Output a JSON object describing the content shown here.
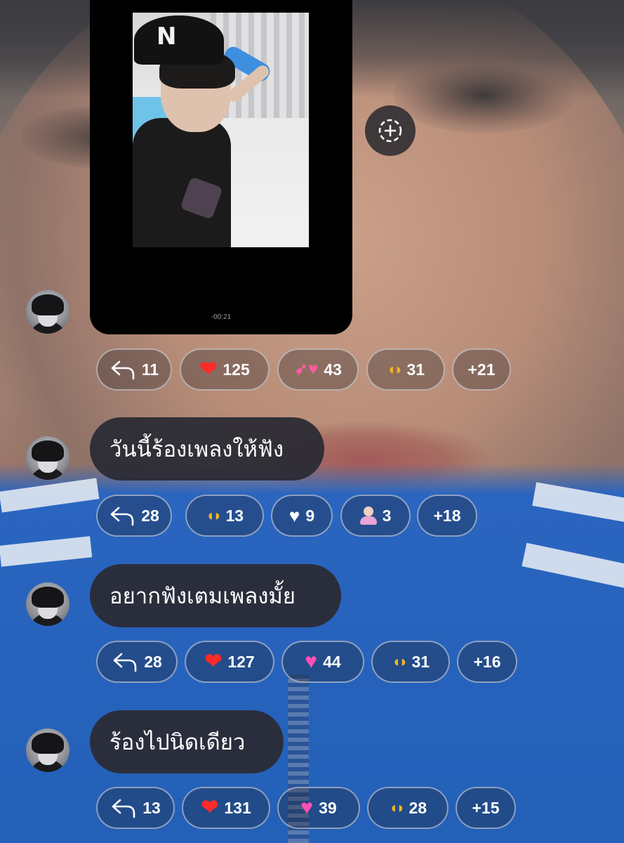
{
  "video": {
    "timecode": "-00:21"
  },
  "add_reaction_icon": "dashed-circle-plus-icon",
  "messages": [
    {
      "text": "",
      "reply_count": "11",
      "reactions": [
        {
          "emoji": "red-heart",
          "count": "125"
        },
        {
          "emoji": "heart-with-arrow",
          "count": "43"
        },
        {
          "emoji": "heart-hands",
          "count": "31"
        }
      ],
      "more": "+21"
    },
    {
      "text": "วันนี้ร้องเพลงให้ฟัง",
      "reply_count": "28",
      "reactions": [
        {
          "emoji": "heart-hands",
          "count": "13"
        },
        {
          "emoji": "white-heart",
          "count": "9"
        },
        {
          "emoji": "person-bowing",
          "count": "3"
        }
      ],
      "more": "+18"
    },
    {
      "text": "อยากฟังเตมเพลงมั้ย",
      "reply_count": "28",
      "reactions": [
        {
          "emoji": "red-heart",
          "count": "127"
        },
        {
          "emoji": "sparkling-pink-heart",
          "count": "44"
        },
        {
          "emoji": "heart-hands",
          "count": "31"
        }
      ],
      "more": "+16"
    },
    {
      "text": "ร้องไปนิดเดียว",
      "reply_count": "13",
      "reactions": [
        {
          "emoji": "red-heart",
          "count": "131"
        },
        {
          "emoji": "pink-heart",
          "count": "39"
        },
        {
          "emoji": "heart-hands",
          "count": "28"
        }
      ],
      "more": "+15"
    }
  ],
  "colors": {
    "bubble": "#2a2b34",
    "pill_border": "#e6e6eb",
    "text": "#ffffff"
  }
}
